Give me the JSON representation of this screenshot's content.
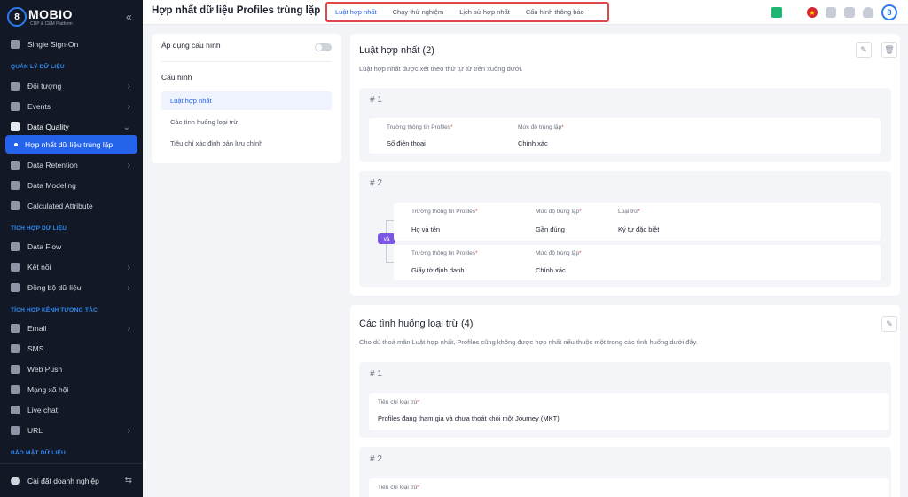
{
  "brand": {
    "logo_text": "MOBIO",
    "logo_sub": "CDP & CEM Platform",
    "logo_glyph": "8"
  },
  "sidebar": {
    "collapse_icon": "«",
    "sso": "Single Sign-On",
    "sections": {
      "data_mgmt": "QUẢN LÝ DỮ LIỆU",
      "data_integration": "TÍCH HỢP DỮ LIỆU",
      "channel_integration": "TÍCH HỢP KÊNH TƯƠNG TÁC",
      "data_security": "BẢO MẬT DỮ LIỆU"
    },
    "items": {
      "objects": "Đối tượng",
      "events": "Events",
      "data_quality": "Data Quality",
      "merge_duplicates": "Hợp nhất dữ liệu trùng lặp",
      "data_retention": "Data Retention",
      "data_modeling": "Data Modeling",
      "calculated_attribute": "Calculated Attribute",
      "data_flow": "Data Flow",
      "connect": "Kết nối",
      "sync": "Đồng bộ dữ liệu",
      "email": "Email",
      "sms": "SMS",
      "web_push": "Web Push",
      "social": "Mạng xã hội",
      "live_chat": "Live chat",
      "url": "URL"
    },
    "footer": "Cài đặt doanh nghiệp"
  },
  "header": {
    "title": "Hợp nhất dữ liệu Profiles trùng lặp",
    "tabs": [
      "Luật hợp nhất",
      "Chạy thử nghiệm",
      "Lịch sử hợp nhất",
      "Cấu hình thông báo"
    ],
    "active_tab": 0,
    "avatar_glyph": "8"
  },
  "config": {
    "apply_label": "Áp dụng cấu hình",
    "apply_enabled": false,
    "section_title": "Cấu hình",
    "items": [
      "Luật hợp nhất",
      "Các tình huống loại trừ",
      "Tiêu chí xác định bản lưu chính"
    ]
  },
  "merge_rules": {
    "title": "Luật hợp nhất (2)",
    "desc": "Luật hợp nhất được xét theo thứ tự từ trên xuống dưới.",
    "rule1": {
      "num": "# 1",
      "field_label": "Trường thông tin Profiles",
      "field_value": "Số điện thoại",
      "level_label": "Mức độ trùng lặp",
      "level_value": "Chính xác"
    },
    "rule2": {
      "num": "# 2",
      "and_label": "và",
      "cond1": {
        "field_label": "Trường thông tin Profiles",
        "field_value": "Họ và tên",
        "level_label": "Mức độ trùng lặp",
        "level_value": "Gần đúng",
        "exclude_label": "Loại trừ",
        "exclude_value": "Ký tự đặc biệt"
      },
      "cond2": {
        "field_label": "Trường thông tin Profiles",
        "field_value": "Giấy tờ định danh",
        "level_label": "Mức độ trùng lặp",
        "level_value": "Chính xác"
      }
    },
    "required_mark": "*"
  },
  "exclusions": {
    "title": "Các tình huống loại trừ (4)",
    "desc": "Cho dù thoả mãn Luật hợp nhất, Profiles cũng không được hợp nhất nếu thuộc một trong các tình huống dưới đây.",
    "case1": {
      "num": "# 1",
      "label": "Tiêu chí loại trừ",
      "value": "Profiles đang tham gia và chưa thoát khỏi một Journey (MKT)"
    },
    "case2": {
      "num": "# 2",
      "label": "Tiêu chí loại trừ"
    }
  },
  "colors": {
    "primary": "#2563eb",
    "sidebar_bg": "#121826",
    "highlight_border": "#e04848",
    "and_badge": "#7b57e4"
  }
}
